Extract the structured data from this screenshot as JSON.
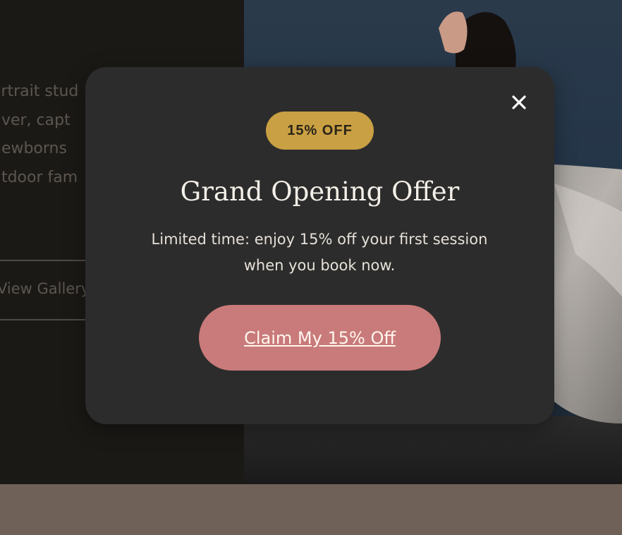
{
  "hero": {
    "lines": [
      "ortrait stud",
      "uver, capt",
      " newborns",
      "utdoor fam"
    ],
    "gallery_link": "View Gallery"
  },
  "modal": {
    "badge": "15% OFF",
    "title": "Grand Opening Offer",
    "description": "Limited time: enjoy 15% off your first session when you book now.",
    "cta_label": "Claim My 15% Off",
    "close_icon": "close-icon"
  },
  "colors": {
    "modal_bg": "#2c2c2c",
    "badge_bg": "#c9a043",
    "cta_bg": "#c97a7a",
    "footer_band": "#6f6158"
  }
}
